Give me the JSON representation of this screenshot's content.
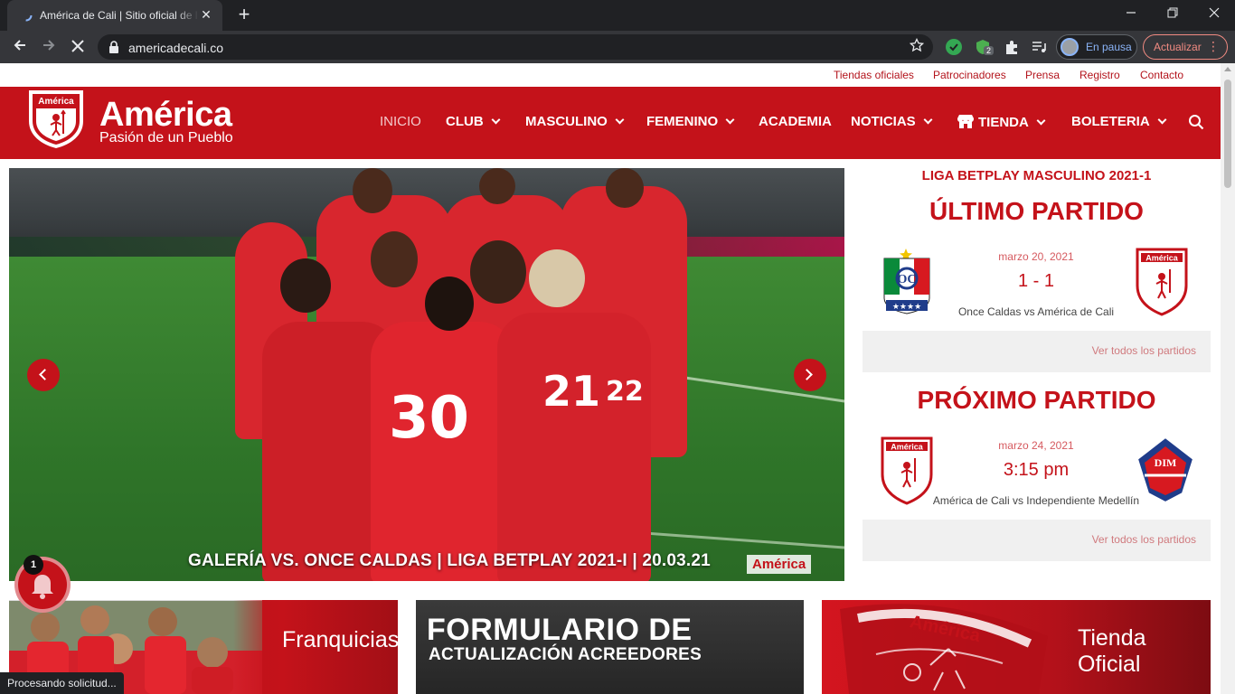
{
  "browser": {
    "tab_title": "América de Cali | Sitio oficial de l",
    "close_glyph": "✕",
    "newtab_glyph": "+",
    "url": "americadecali.co",
    "profile_label": "En pausa",
    "update_label": "Actualizar",
    "extension_badge": "2",
    "status_text": "Procesando solicitud..."
  },
  "site": {
    "topnav": [
      "Tiendas oficiales",
      "Patrocinadores",
      "Prensa",
      "Registro",
      "Contacto"
    ],
    "brand": "América",
    "tagline": "Pasión de un Pueblo",
    "logo_text": "América",
    "menu": {
      "inicio": "INICIO",
      "club": "CLUB",
      "masculino": "MASCULINO",
      "femenino": "FEMENINO",
      "academia": "ACADEMIA",
      "noticias": "NOTICIAS",
      "tienda": "TIENDA",
      "boleteria": "BOLETERIA"
    }
  },
  "slider": {
    "caption": "GALERÍA VS. ONCE CALDAS | LIGA BETPLAY 2021-I | 20.03.21",
    "watermark": "América",
    "jersey_numbers": [
      "30",
      "22",
      "21"
    ]
  },
  "matches": {
    "league": "LIGA BETPLAY MASCULINO 2021-1",
    "last": {
      "title": "ÚLTIMO PARTIDO",
      "date": "marzo 20, 2021",
      "score": "1 - 1",
      "teams": "Once Caldas vs América de Cali",
      "home_crest": "OC",
      "away_crest": "América",
      "link": "Ver todos los partidos"
    },
    "next": {
      "title": "PRÓXIMO PARTIDO",
      "date": "marzo 24, 2021",
      "time": "3:15 pm",
      "teams": "América de Cali vs Independiente Medellín",
      "home_crest": "América",
      "away_crest": "DIM",
      "link": "Ver todos los partidos"
    }
  },
  "cards": {
    "franquicias": "Franquicias",
    "formulario_big": "FORMULARIO DE",
    "formulario_small": "ACTUALIZACIÓN ACREEDORES",
    "tienda": "Tienda Oficial",
    "tienda_crest": "América"
  },
  "notifications": {
    "count": "1"
  },
  "colors": {
    "brand_red": "#c4121a",
    "chrome_dark": "#202124",
    "chrome_bar": "#35363a"
  }
}
